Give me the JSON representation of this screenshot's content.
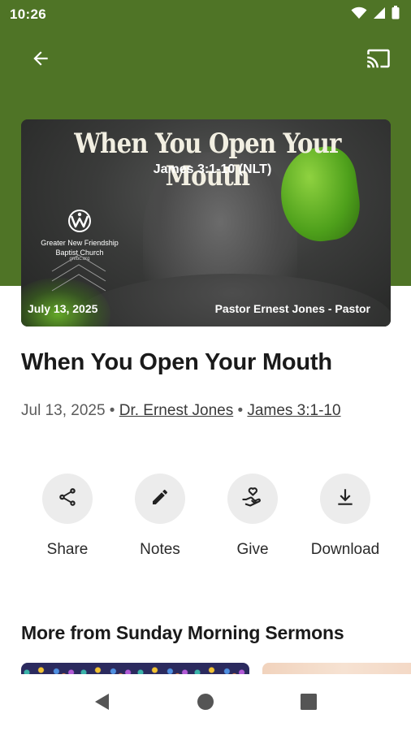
{
  "status_bar": {
    "time": "10:26",
    "icons": [
      "wifi-icon",
      "signal-icon",
      "battery-icon"
    ]
  },
  "toolbar": {
    "back_icon": "arrow-back-icon",
    "cast_icon": "cast-icon"
  },
  "colors": {
    "header_green": "#4f7426",
    "action_bg": "#ececec",
    "text_primary": "#1a1a1a",
    "text_secondary": "#5c5c5c"
  },
  "hero": {
    "title": "When You Open Your Mouth",
    "scripture": "James 3:1-10 (NLT)",
    "church_name": "Greater New Friendship",
    "church_sub": "Baptist Church",
    "church_web": "gnfbc.org",
    "date": "July 13, 2025",
    "pastor": "Pastor Ernest Jones - Pastor"
  },
  "sermon": {
    "title": "When You Open Your Mouth",
    "date": "Jul 13, 2025",
    "separator": " • ",
    "speaker": "Dr. Ernest Jones",
    "scripture": "James 3:1-10"
  },
  "actions": [
    {
      "label": "Share",
      "icon": "share-icon"
    },
    {
      "label": "Notes",
      "icon": "pencil-icon"
    },
    {
      "label": "Give",
      "icon": "give-hand-heart-icon"
    },
    {
      "label": "Download",
      "icon": "download-icon"
    }
  ],
  "more": {
    "title": "More from Sunday Morning Sermons"
  },
  "nav": {
    "icons": [
      "nav-back-icon",
      "nav-home-icon",
      "nav-recents-icon"
    ]
  }
}
